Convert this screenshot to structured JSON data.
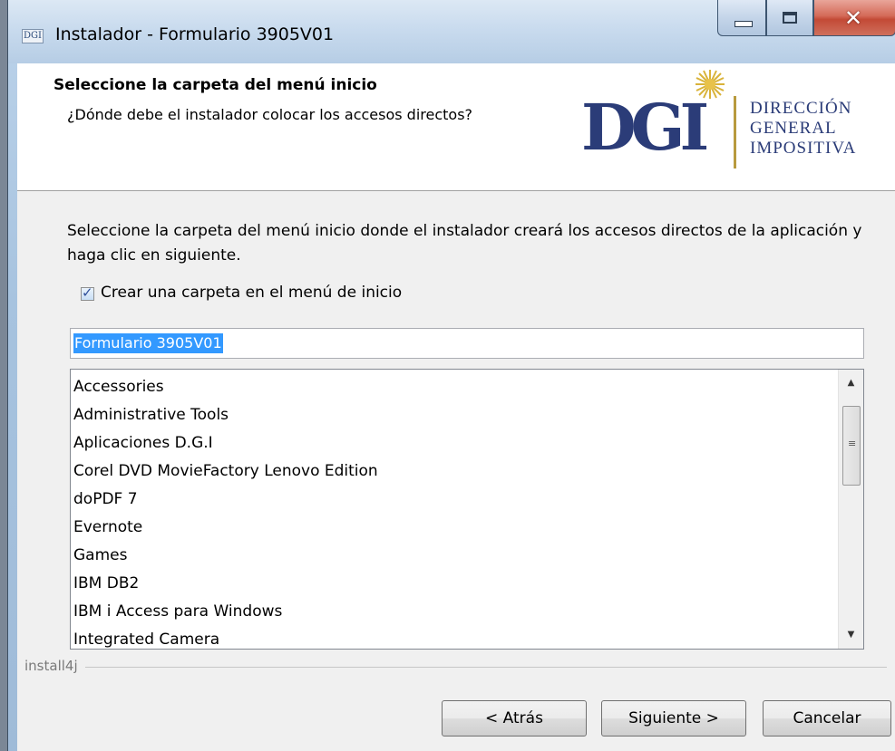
{
  "window": {
    "title": "Instalador - Formulario 3905V01",
    "icon_text": "DGI"
  },
  "header": {
    "title": "Seleccione la carpeta del menú inicio",
    "subtitle": "¿Dónde debe el instalador colocar los accesos directos?",
    "logo": {
      "letters": "DGI",
      "line1": "DIRECCIÓN",
      "line2": "GENERAL",
      "line3": "IMPOSITIVA"
    }
  },
  "body": {
    "intro": "Seleccione la carpeta del menú inicio donde el instalador creará los accesos directos de la aplicación y haga clic en siguiente.",
    "checkbox_label": "Crear una carpeta en el menú de inicio",
    "checkbox_checked": true,
    "folder_value": "Formulario 3905V01",
    "folders": [
      "Accessories",
      "Administrative Tools",
      "Aplicaciones D.G.I",
      "Corel DVD MovieFactory Lenovo Edition",
      "doPDF 7",
      "Evernote",
      "Games",
      "IBM DB2",
      "IBM i Access para Windows",
      "Integrated Camera"
    ]
  },
  "footer": {
    "brand": "install4j",
    "back_label": "< Atrás",
    "next_label": "Siguiente >",
    "cancel_label": "Cancelar"
  },
  "colors": {
    "logo_blue": "#2b3c78",
    "logo_gold": "#b89a3e",
    "selection": "#3399ff"
  }
}
